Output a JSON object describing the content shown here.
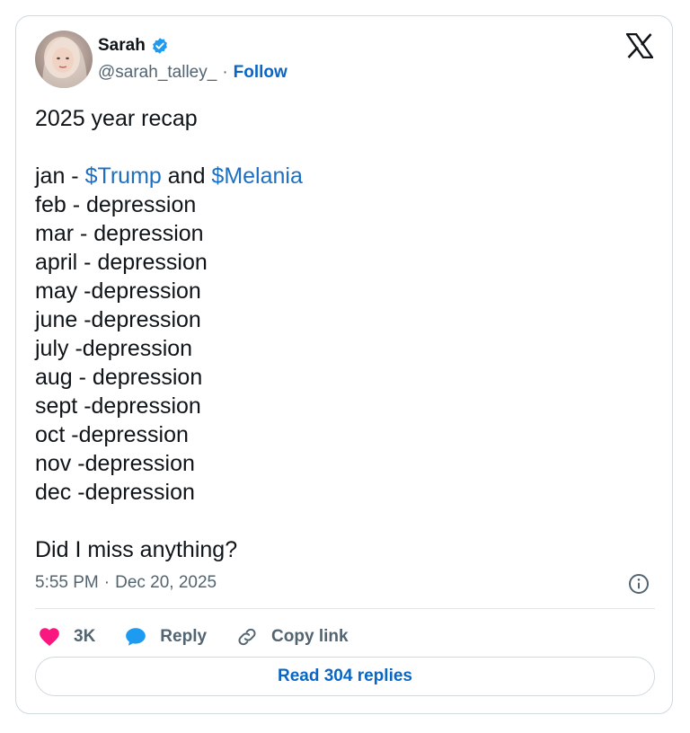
{
  "author": {
    "display_name": "Sarah",
    "handle": "@sarah_talley_",
    "separator": "·",
    "follow_label": "Follow"
  },
  "tweet": {
    "title_line": "2025 year recap",
    "jan_prefix": "jan - ",
    "cashtag_1": "$Trump",
    "jan_middle": " and ",
    "cashtag_2": "$Melania",
    "months": [
      "feb - depression",
      "mar - depression",
      "april - depression",
      "may -depression",
      "june -depression",
      "july -depression",
      "aug - depression",
      "sept -depression",
      "oct -depression",
      "nov -depression",
      "dec -depression"
    ],
    "closing": "Did I miss anything?"
  },
  "meta": {
    "time": "5:55 PM",
    "separator": "·",
    "date": "Dec 20, 2025"
  },
  "actions": {
    "likes_count": "3K",
    "reply_label": "Reply",
    "copy_label": "Copy link"
  },
  "footer": {
    "read_replies_label": "Read 304 replies"
  },
  "icons": {
    "verified": "verified-badge-icon",
    "logo": "x-logo-icon",
    "info": "info-icon",
    "like": "heart-icon",
    "reply": "speech-bubble-icon",
    "copy": "link-icon"
  },
  "colors": {
    "link": "#1d6fc2",
    "follow": "#0a66c2",
    "heart": "#f91880",
    "reply_bubble": "#1d9bf0",
    "muted": "#536471",
    "border": "#cfd9de"
  }
}
